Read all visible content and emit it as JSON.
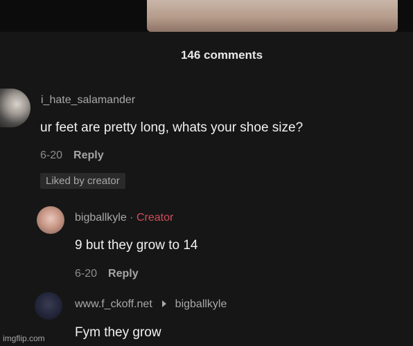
{
  "header": {
    "comments_count": "146 comments"
  },
  "comments": [
    {
      "username": "i_hate_salamander",
      "text": "ur feet are pretty long, whats your shoe size?",
      "date": "6-20",
      "reply_label": "Reply",
      "badge": "Liked by creator"
    },
    {
      "username": "bigballkyle",
      "separator": "·",
      "creator_tag": "Creator",
      "text": "9 but they grow to 14",
      "date": "6-20",
      "reply_label": "Reply"
    },
    {
      "username": "www.f_ckoff.net",
      "replying_to": "bigballkyle",
      "text": "Fym they grow"
    }
  ],
  "watermark": "imgflip.com",
  "colors": {
    "background": "#161616",
    "creator_accent": "#d14d5b",
    "muted_text": "#8d8d8d"
  },
  "icons": {
    "reply_arrow": "triangle-right-icon"
  }
}
